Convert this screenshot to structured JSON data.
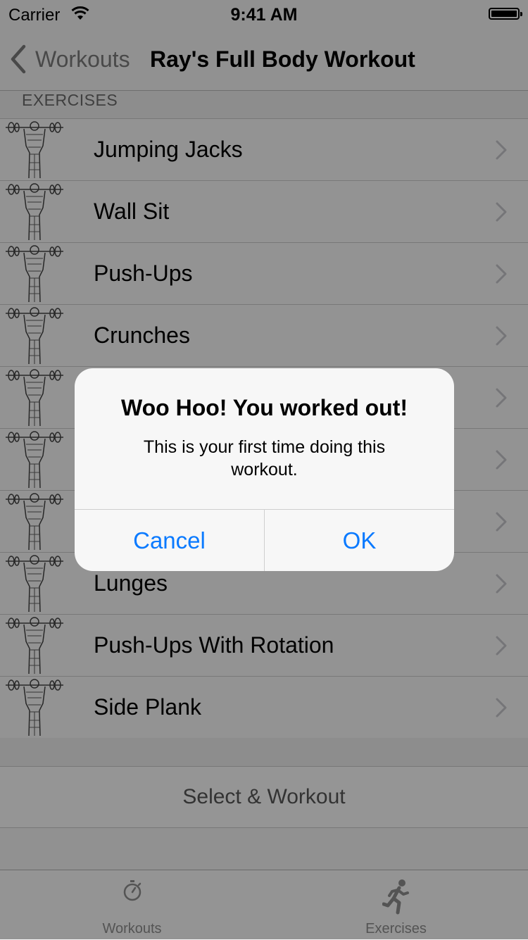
{
  "status_bar": {
    "carrier": "Carrier",
    "time": "9:41 AM"
  },
  "nav": {
    "back_label": "Workouts",
    "title": "Ray's Full Body Workout"
  },
  "section_header": "EXERCISES",
  "exercises": [
    {
      "name": "Jumping Jacks"
    },
    {
      "name": "Wall Sit"
    },
    {
      "name": "Push-Ups"
    },
    {
      "name": "Crunches"
    },
    {
      "name": ""
    },
    {
      "name": ""
    },
    {
      "name": ""
    },
    {
      "name": "Lunges"
    },
    {
      "name": "Push-Ups With Rotation"
    },
    {
      "name": "Side Plank"
    }
  ],
  "select_button": "Select & Workout",
  "tabs": [
    {
      "label": "Workouts",
      "icon": "stopwatch-icon"
    },
    {
      "label": "Exercises",
      "icon": "running-figure-icon"
    }
  ],
  "alert": {
    "title": "Woo Hoo! You worked out!",
    "message": "This is your first time doing this workout.",
    "cancel_label": "Cancel",
    "ok_label": "OK"
  },
  "colors": {
    "accent": "#0a7aff",
    "dim_overlay": "rgba(0,0,0,0.40)"
  }
}
